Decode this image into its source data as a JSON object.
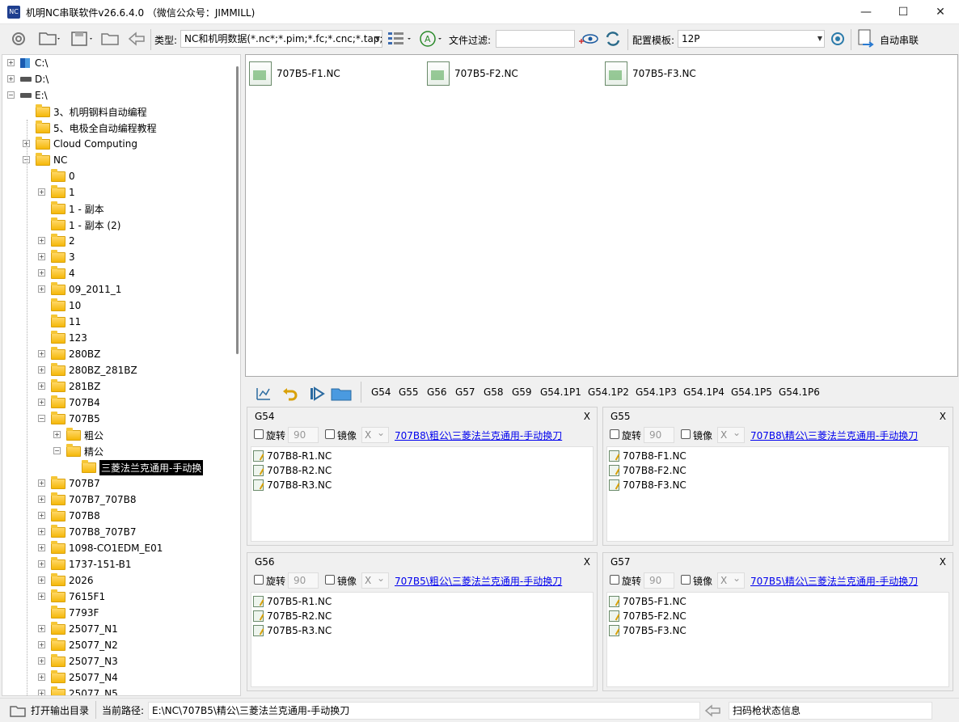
{
  "window": {
    "title": "机明NC串联软件v26.6.4.0 （微信公众号：JIMMILL)",
    "controls": [
      "—",
      "☐",
      "✕"
    ]
  },
  "toolbar": {
    "type_label": "类型:",
    "type_value": "NC和机明数据(*.nc*;*.pim;*.fc;*.cnc;*.tap;",
    "filter_label": "文件过滤:",
    "filter_value": "",
    "template_label": "配置模板:",
    "template_value": "12P",
    "auto_label": "自动串联"
  },
  "tree": {
    "drives": [
      "C:\\",
      "D:\\",
      "E:\\"
    ],
    "items": [
      "3、机明钢料自动编程",
      "5、电极全自动编程教程",
      "Cloud Computing",
      "NC",
      "0",
      "1",
      "1 - 副本",
      "1 - 副本 (2)",
      "2",
      "3",
      "4",
      "09_2011_1",
      "10",
      "11",
      "123",
      "280BZ",
      "280BZ_281BZ",
      "281BZ",
      "707B4",
      "707B5",
      "粗公",
      "精公",
      "三菱法兰克通用-手动换",
      "707B7",
      "707B7_707B8",
      "707B8",
      "707B8_707B7",
      "1098-CO1EDM_E01",
      "1737-151-B1",
      "2026",
      "7615F1",
      "7793F",
      "25077_N1",
      "25077_N2",
      "25077_N3",
      "25077_N4",
      "25077_N5"
    ]
  },
  "files": [
    "707B5-F1.NC",
    "707B5-F2.NC",
    "707B5-F3.NC"
  ],
  "gtabs": [
    "G54",
    "G55",
    "G56",
    "G57",
    "G58",
    "G59",
    "G54.1P1",
    "G54.1P2",
    "G54.1P3",
    "G54.1P4",
    "G54.1P5",
    "G54.1P6"
  ],
  "panels": [
    {
      "title": "G54",
      "close": "X",
      "rotate_label": "旋转",
      "rotate_value": "90",
      "mirror_label": "镜像",
      "axis": "X",
      "link": "707B8\\粗公\\三菱法兰克通用-手动换刀",
      "files": [
        "707B8-R1.NC",
        "707B8-R2.NC",
        "707B8-R3.NC"
      ]
    },
    {
      "title": "G55",
      "close": "X",
      "rotate_label": "旋转",
      "rotate_value": "90",
      "mirror_label": "镜像",
      "axis": "X",
      "link": "707B8\\精公\\三菱法兰克通用-手动换刀",
      "files": [
        "707B8-F1.NC",
        "707B8-F2.NC",
        "707B8-F3.NC"
      ]
    },
    {
      "title": "G56",
      "close": "X",
      "rotate_label": "旋转",
      "rotate_value": "90",
      "mirror_label": "镜像",
      "axis": "X",
      "link": "707B5\\粗公\\三菱法兰克通用-手动换刀",
      "files": [
        "707B5-R1.NC",
        "707B5-R2.NC",
        "707B5-R3.NC"
      ]
    },
    {
      "title": "G57",
      "close": "X",
      "rotate_label": "旋转",
      "rotate_value": "90",
      "mirror_label": "镜像",
      "axis": "X",
      "link": "707B5\\精公\\三菱法兰克通用-手动换刀",
      "files": [
        "707B5-F1.NC",
        "707B5-F2.NC",
        "707B5-F3.NC"
      ]
    }
  ],
  "status": {
    "open_output": "打开输出目录",
    "path_label": "当前路径:",
    "path_value": "E:\\NC\\707B5\\精公\\三菱法兰克通用-手动换刀",
    "scanner_status": "扫码枪状态信息"
  }
}
